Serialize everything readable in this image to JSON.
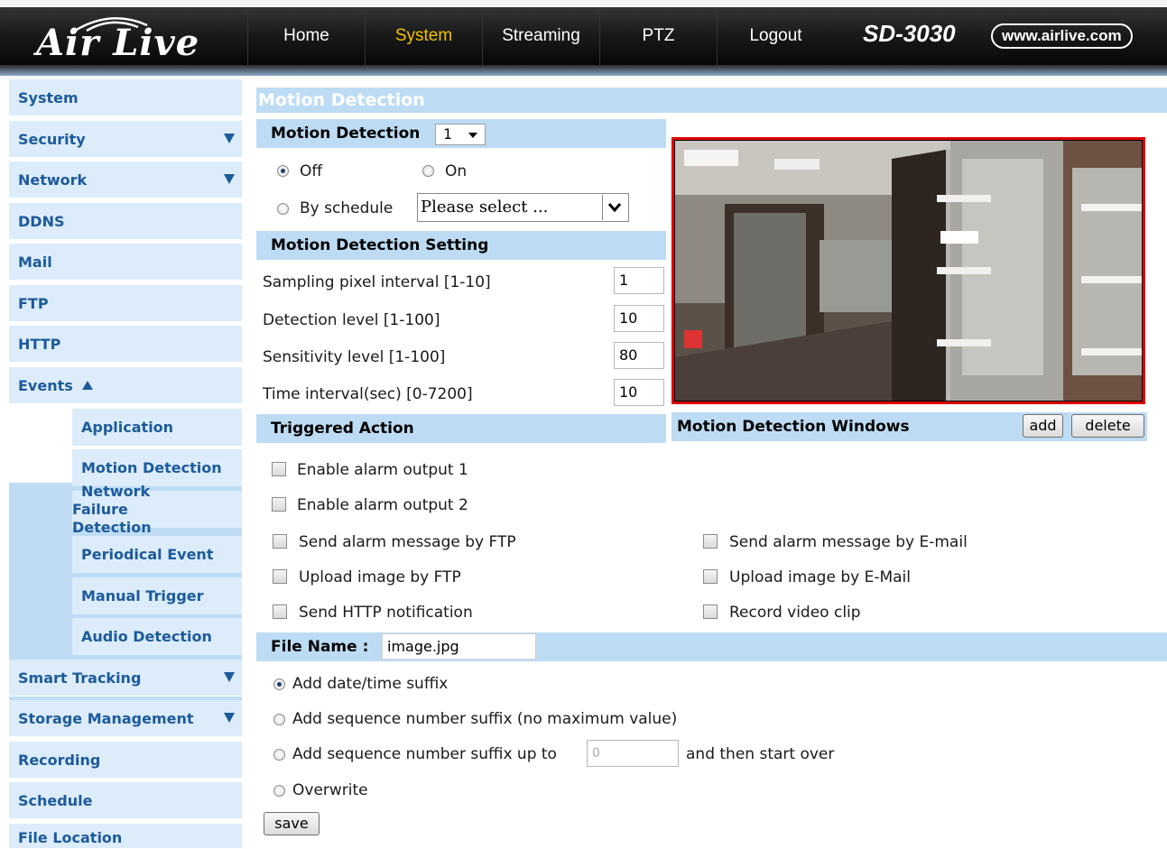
{
  "brand": {
    "logo_text": "Air Live",
    "model": "SD-3030",
    "website": "www.airlive.com"
  },
  "nav": {
    "tabs": [
      "Home",
      "System",
      "Streaming",
      "PTZ",
      "Logout"
    ]
  },
  "sidebar": {
    "items": [
      "System",
      "Security",
      "Network",
      "DDNS",
      "Mail",
      "FTP",
      "HTTP",
      "Events",
      "Smart Tracking",
      "Storage Management",
      "Recording",
      "Schedule",
      "File Location"
    ],
    "sub_items": [
      "Application",
      "Motion Detection",
      "Network Failure Detection",
      "Periodical Event",
      "Manual Trigger",
      "Audio Detection"
    ]
  },
  "page": {
    "title": "Motion Detection"
  },
  "motion": {
    "label": "Motion Detection",
    "select_value": "1",
    "off_label": "Off",
    "on_label": "On",
    "schedule_label": "By schedule",
    "schedule_select": "Please select ..."
  },
  "settings": {
    "header": "Motion Detection Setting",
    "rows": [
      {
        "label": "Sampling pixel interval [1-10]",
        "value": "1"
      },
      {
        "label": "Detection level [1-100]",
        "value": "10"
      },
      {
        "label": "Sensitivity level [1-100]",
        "value": "80"
      },
      {
        "label": "Time interval(sec) [0-7200]",
        "value": "10"
      }
    ]
  },
  "windows": {
    "header": "Motion Detection Windows",
    "add_label": "add",
    "delete_label": "delete"
  },
  "triggered": {
    "header": "Triggered Action",
    "alarm1": "Enable alarm output 1",
    "alarm2": "Enable alarm output 2",
    "ftp_msg": "Send alarm message by FTP",
    "email_msg": "Send alarm message by E-mail",
    "ftp_upload": "Upload image by FTP",
    "email_upload": "Upload image by E-Mail",
    "http_notify": "Send HTTP notification",
    "record_clip": "Record video clip"
  },
  "file": {
    "label": "File Name :",
    "value": "image.jpg",
    "opt_datetime": "Add date/time suffix",
    "opt_seq": "Add sequence number suffix (no maximum value)",
    "opt_seq_upto": "Add sequence number suffix up to",
    "seq_placeholder": "0",
    "opt_seq_after": "and then start over",
    "opt_overwrite": "Overwrite",
    "save_label": "save"
  },
  "colors": {
    "accent_blue": "#1c5a9b",
    "section_bg": "#bddcf4",
    "nav_active": "#f2c200",
    "video_border": "#e00000"
  }
}
